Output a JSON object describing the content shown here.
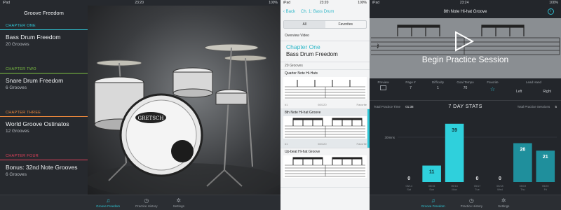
{
  "panel1": {
    "status": {
      "device": "iPad",
      "time": "23:20",
      "battery": "100%"
    },
    "nav_title": "Groove Freedom",
    "chapters": [
      {
        "tag": "CHAPTER ONE",
        "title": "Bass Drum Freedom",
        "sub": "20 Grooves",
        "color": "#2fc8d8"
      },
      {
        "tag": "CHAPTER TWO",
        "title": "Snare Drum Freedom",
        "sub": "6 Grooves",
        "color": "#7dc242"
      },
      {
        "tag": "CHAPTER THREE",
        "title": "World Groove Ostinatos",
        "sub": "12 Grooves",
        "color": "#f08a3c"
      },
      {
        "tag": "CHAPTER FOUR",
        "title": "Bonus: 32nd Note Grooves",
        "sub": "6 Grooves",
        "color": "#e0405a"
      }
    ],
    "drum_brand": "GRETSCH",
    "tabs": [
      {
        "label": "Groove Freedom",
        "icon": "music-note-icon",
        "glyph": "♫"
      },
      {
        "label": "Practice History",
        "icon": "clock-icon",
        "glyph": "◷"
      },
      {
        "label": "Settings",
        "icon": "gear-icon",
        "glyph": "✲"
      }
    ]
  },
  "panel2": {
    "status": {
      "device": "iPad",
      "time": "23:20",
      "battery": "100%"
    },
    "back_label": "Back",
    "nav_title": "Ch. 1: Bass Drum",
    "segments": [
      "All",
      "Favorites"
    ],
    "overview": "Overview Video",
    "chapter_tag": "Chapter One",
    "chapter_title": "Bass Drum Freedom",
    "groove_count": "20 Grooves",
    "grooves": [
      {
        "name": "Quarter Note Hi-Hats",
        "num": "#1",
        "bpm": "60/120",
        "fav": "Favorite"
      },
      {
        "name": "8th Note Hi-hat Groove",
        "num": "#1",
        "bpm": "60/120",
        "fav": "Favorite"
      },
      {
        "name": "Up-beat Hi-hat Groove",
        "num": "",
        "bpm": "",
        "fav": ""
      }
    ]
  },
  "panel3": {
    "status": {
      "device": "iPad",
      "time": "23:24",
      "battery": "100%"
    },
    "nav_title": "8th Note Hi-hat Groove",
    "cta": "Begin Practice Session",
    "controls": [
      {
        "label": "Preview",
        "value": ""
      },
      {
        "label": "Page #",
        "value": "7"
      },
      {
        "label": "Difficulty",
        "value": "1"
      },
      {
        "label": "Goal Tempo",
        "value": "70"
      },
      {
        "label": "Favorite",
        "value": "☆"
      }
    ],
    "lead_hand": {
      "label": "Lead Hand",
      "left": "Left",
      "right": "Right"
    },
    "total_time_label": "Total Practice Time",
    "total_time": "01:38",
    "stats_title": "7 DAY STATS",
    "total_sessions_label": "Total Practice Sessions",
    "total_sessions": "5",
    "y_tick": "30mins"
  },
  "chart_data": {
    "type": "bar",
    "title": "7 DAY STATS",
    "categories": [
      "Sat",
      "Sun",
      "Mon",
      "Tue",
      "Wed",
      "Thu",
      "Fri"
    ],
    "dates": [
      "05/14",
      "05/15",
      "05/16",
      "05/17",
      "05/18",
      "05/19",
      "05/20"
    ],
    "values": [
      0,
      11,
      39,
      0,
      0,
      26,
      21
    ],
    "ylim": [
      0,
      45
    ],
    "highlight": [
      false,
      true,
      true,
      false,
      false,
      false,
      false
    ],
    "colors": {
      "highlight": "#2fd0dc",
      "normal": "#1f8f9c"
    }
  }
}
